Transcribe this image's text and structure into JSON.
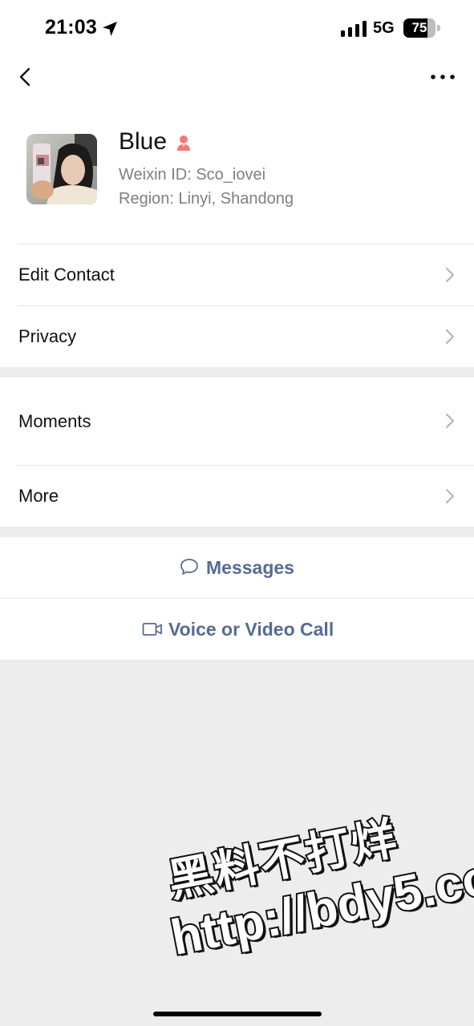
{
  "status_bar": {
    "time": "21:03",
    "network": "5G",
    "battery_level": "75",
    "battery_fraction": 0.75,
    "icons": [
      "location-arrow-icon",
      "signal-icon",
      "battery-icon"
    ]
  },
  "nav": {
    "back_icon": "chevron-left-icon",
    "more_icon": "more-dots-icon"
  },
  "profile": {
    "name": "Blue",
    "gender_icon": "female-icon",
    "weixin_id": "Weixin ID: Sco_iovei",
    "region": "Region: Linyi, Shandong"
  },
  "rows": {
    "edit_contact": "Edit Contact",
    "privacy": "Privacy",
    "moments": "Moments",
    "more": "More"
  },
  "actions": {
    "messages": "Messages",
    "call": "Voice or Video Call"
  },
  "watermark": {
    "line1": "黑料不打烊",
    "line2": "http://bdy5.co"
  },
  "colors": {
    "link": "#576b95",
    "background": "#ededed",
    "gender_icon": "#f37a7a"
  }
}
